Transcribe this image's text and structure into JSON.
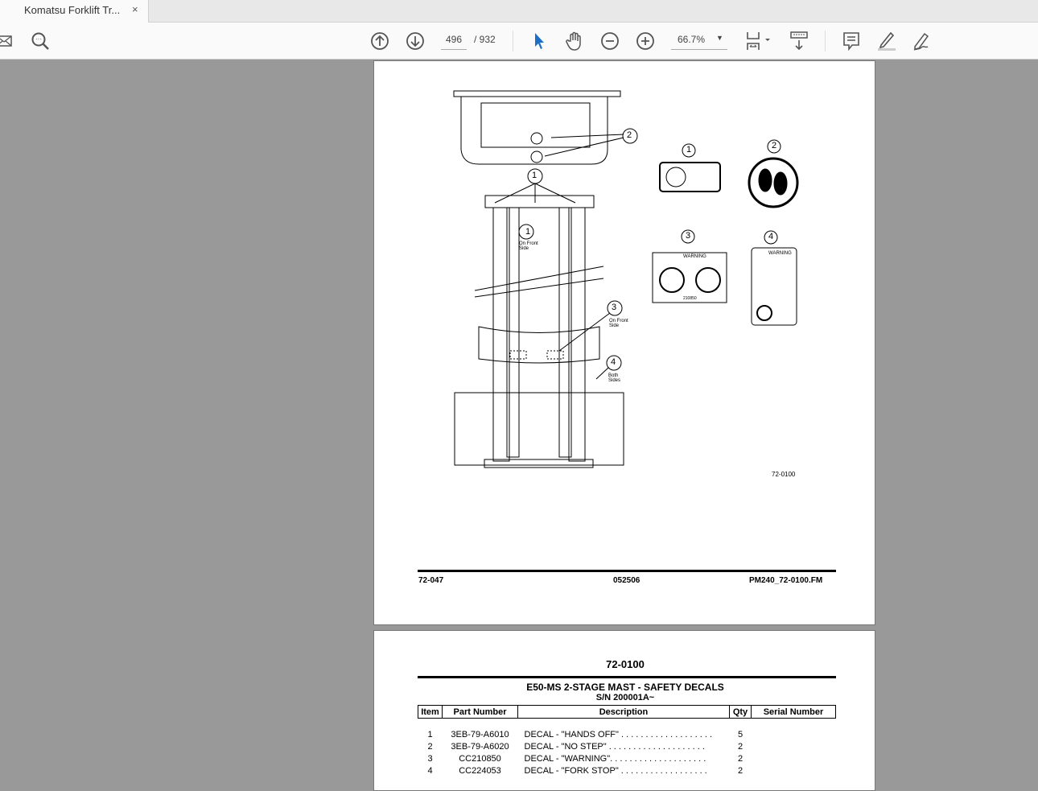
{
  "tab": {
    "title": "Komatsu Forklift Tr...",
    "close": "×"
  },
  "toolbar": {
    "page_current": "496",
    "page_total": "/ 932",
    "zoom": "66.7%"
  },
  "page1": {
    "callouts": [
      "1",
      "2",
      "1",
      "3",
      "4",
      "1",
      "2",
      "3",
      "4"
    ],
    "notes": {
      "front1": "On Front Side",
      "front3": "On Front Side",
      "both": "Both Sides"
    },
    "decal_warning": "WARNING",
    "decal_code": "210850",
    "figure_id": "72-0100",
    "footer": {
      "left": "72-047",
      "center": "052506",
      "right": "PM240_72-0100.FM"
    }
  },
  "page2": {
    "heading": "72-0100",
    "title": "E50-MS 2-STAGE MAST - SAFETY DECALS",
    "subtitle": "S/N 200001A~",
    "columns": [
      "Item",
      "Part Number",
      "Description",
      "Qty",
      "Serial Number"
    ],
    "rows": [
      {
        "item": "1",
        "part": "3EB-79-A6010",
        "desc": "DECAL - \"HANDS OFF\" . . . . . . . . . . . . . . . . . . .",
        "qty": "5",
        "serial": ""
      },
      {
        "item": "2",
        "part": "3EB-79-A6020",
        "desc": "DECAL - \"NO STEP\"  . . . . . . . . . . . . . . . . . . . .",
        "qty": "2",
        "serial": ""
      },
      {
        "item": "3",
        "part": "CC210850",
        "desc": "DECAL - \"WARNING\". . . . . . . . . . . . . . . . . . . .",
        "qty": "2",
        "serial": ""
      },
      {
        "item": "4",
        "part": "CC224053",
        "desc": "DECAL - \"FORK STOP\" . . . . . . . . . . . . . . . . . .",
        "qty": "2",
        "serial": ""
      }
    ]
  }
}
